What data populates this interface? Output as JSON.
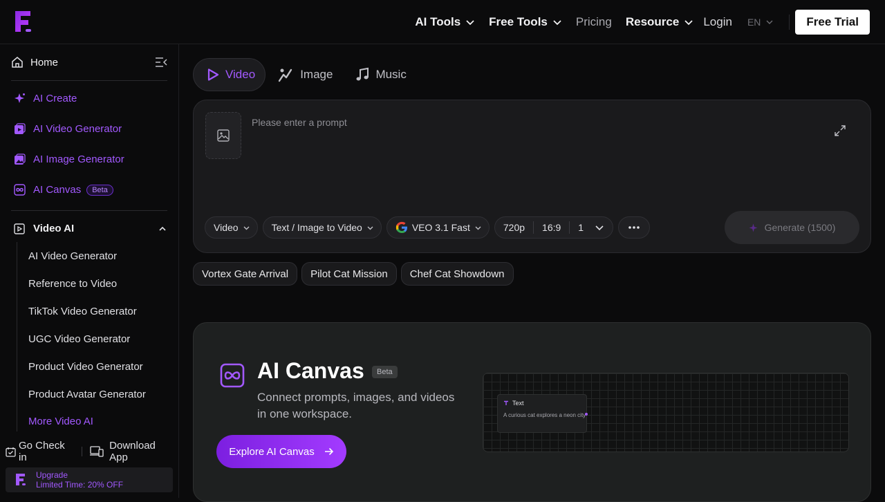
{
  "nav": {
    "ai_tools": "AI Tools",
    "free_tools": "Free Tools",
    "pricing": "Pricing",
    "resource": "Resource",
    "login": "Login",
    "lang": "EN",
    "free_trial": "Free Trial"
  },
  "sidebar": {
    "home": "Home",
    "links": [
      {
        "label": "AI Create",
        "icon": "sparkle-icon"
      },
      {
        "label": "AI Video Generator",
        "icon": "video-gen-icon"
      },
      {
        "label": "AI Image Generator",
        "icon": "image-gen-icon"
      },
      {
        "label": "AI Canvas",
        "icon": "canvas-icon",
        "badge": "Beta"
      }
    ],
    "section_title": "Video AI",
    "sub_items": [
      "AI Video Generator",
      "Reference to Video",
      "TikTok Video Generator",
      "UGC Video Generator",
      "Product Video Generator",
      "Product Avatar Generator"
    ],
    "more": "More Video AI",
    "check_in": "Go Check in",
    "download": "Download App",
    "upgrade_title": "Upgrade",
    "upgrade_offer": "Limited Time: 20% OFF"
  },
  "tabs": [
    {
      "label": "Video",
      "icon": "play-icon",
      "active": true
    },
    {
      "label": "Image",
      "icon": "image-brush-icon",
      "active": false
    },
    {
      "label": "Music",
      "icon": "music-note-icon",
      "active": false
    }
  ],
  "prompt": {
    "placeholder": "Please enter a prompt",
    "value": ""
  },
  "controls": {
    "mode": "Video",
    "type": "Text / Image to Video",
    "model": "VEO 3.1 Fast",
    "resolution": "720p",
    "ratio": "16:9",
    "count": "1",
    "generate": "Generate (1500)"
  },
  "suggestions": [
    "Vortex Gate Arrival",
    "Pilot Cat Mission",
    "Chef Cat Showdown"
  ],
  "canvas_card": {
    "title": "AI Canvas",
    "badge": "Beta",
    "description": "Connect prompts, images, and videos in one workspace.",
    "cta": "Explore AI Canvas",
    "node_title": "Text",
    "node_text": "A curious cat explores a neon city"
  },
  "colors": {
    "accent": "#a259ff",
    "background": "#0b0b0c",
    "panel": "#1a1a1c"
  }
}
